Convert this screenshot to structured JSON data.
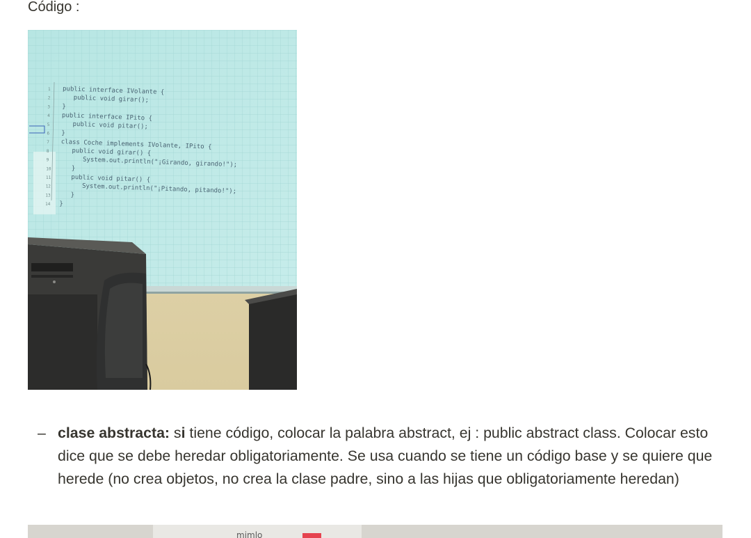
{
  "heading": "Código :",
  "photo": {
    "code_lines": [
      "public interface IVolante {",
      "public void girar();",
      "}",
      "public interface IPito {",
      "public void pitar();",
      "}",
      "class Coche implements IVolante, IPito {",
      "public void girar() {",
      "System.out.println(\"¡Girando, girando!\");",
      "}",
      "public void pitar() {",
      "System.out.println(\"¡Pitando, pitando!\");",
      "}",
      "}"
    ],
    "line_numbers": [
      "1",
      "2",
      "3",
      "4",
      "5",
      "6",
      "7",
      "8",
      "9",
      "10",
      "11",
      "12",
      "13",
      "14"
    ]
  },
  "bullet": {
    "dash": "–",
    "term": "clase abstracta:",
    "s_part": " s",
    "i_part": "i",
    "rest": " tiene código, colocar la palabra abstract, ej : public abstract class. Colocar esto dice que se debe heredar obligatoriamente. Se usa cuando se tiene un código base y se quiere que herede (no crea objetos, no crea la clase padre, sino a las hijas que obligatoriamente heredan)"
  },
  "photo2": {
    "partial_text": "mimlo"
  }
}
